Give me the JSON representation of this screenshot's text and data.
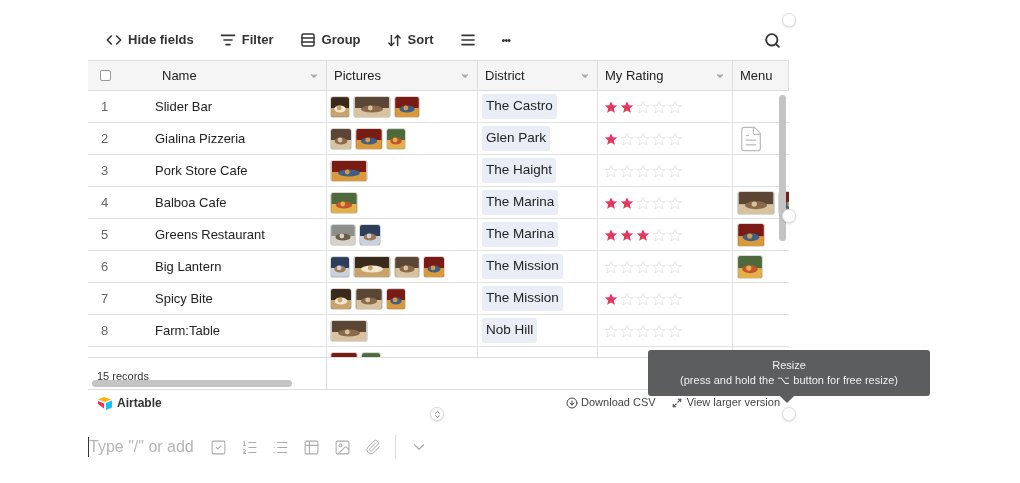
{
  "toolbar": [
    {
      "kind": "hide",
      "label": "Hide fields"
    },
    {
      "kind": "filter",
      "label": "Filter"
    },
    {
      "kind": "group",
      "label": "Group"
    },
    {
      "kind": "sort",
      "label": "Sort"
    },
    {
      "kind": "height"
    },
    {
      "kind": "more",
      "label": "•••"
    },
    {
      "kind": "search"
    }
  ],
  "table": {
    "select_all": {
      "checked": false
    },
    "columns": [
      "Name",
      "Pictures",
      "District",
      "My Rating",
      "Menu"
    ],
    "rows": [
      {
        "number": "1",
        "name": "Slider Bar",
        "pictures": [
          {
            "kind": "picture"
          },
          {
            "kind": "picture"
          },
          {
            "kind": "picture"
          }
        ],
        "district": "The Castro",
        "stars": 2,
        "menu": []
      },
      {
        "number": "2",
        "name": "Gialina Pizzeria",
        "pictures": [
          {
            "kind": "picture"
          },
          {
            "kind": "picture"
          },
          {
            "kind": "picture"
          }
        ],
        "district": "Glen Park",
        "stars": 1,
        "menu": [
          {
            "kind": "file"
          }
        ]
      },
      {
        "number": "3",
        "name": "Pork Store Cafe",
        "pictures": [
          {
            "kind": "picture"
          }
        ],
        "district": "The Haight",
        "stars": 0,
        "menu": []
      },
      {
        "number": "4",
        "name": "Balboa Cafe",
        "pictures": [
          {
            "kind": "picture"
          }
        ],
        "district": "The Marina",
        "stars": 2,
        "menu": [
          {
            "kind": "picture"
          },
          {
            "kind": "picture"
          }
        ]
      },
      {
        "number": "5",
        "name": "Greens Restaurant",
        "pictures": [
          {
            "kind": "picture"
          },
          {
            "kind": "picture"
          }
        ],
        "district": "The Marina",
        "stars": 3,
        "menu": [
          {
            "kind": "picture"
          }
        ]
      },
      {
        "number": "6",
        "name": "Big Lantern",
        "pictures": [
          {
            "kind": "picture"
          },
          {
            "kind": "picture"
          },
          {
            "kind": "picture"
          },
          {
            "kind": "picture"
          }
        ],
        "district": "The Mission",
        "stars": 0,
        "menu": [
          {
            "kind": "picture"
          }
        ]
      },
      {
        "number": "7",
        "name": "Spicy Bite",
        "pictures": [
          {
            "kind": "picture"
          },
          {
            "kind": "picture"
          },
          {
            "kind": "picture"
          }
        ],
        "district": "The Mission",
        "stars": 1,
        "menu": []
      },
      {
        "number": "8",
        "name": "Farm:Table",
        "pictures": [
          {
            "kind": "picture"
          }
        ],
        "district": "Nob Hill",
        "stars": 0,
        "menu": []
      },
      {
        "pictures": [
          {
            "kind": "picture"
          },
          {
            "kind": "picture"
          }
        ]
      }
    ],
    "record_count": "15 records"
  },
  "footer": {
    "logo": "Airtable",
    "download": "Download CSV",
    "larger": "View larger version"
  },
  "tooltip": {
    "title": "Resize",
    "hint": "(press and hold the ⌥ button for free resize)"
  },
  "editor": {
    "placeholder": "Type \"/\" or add"
  }
}
